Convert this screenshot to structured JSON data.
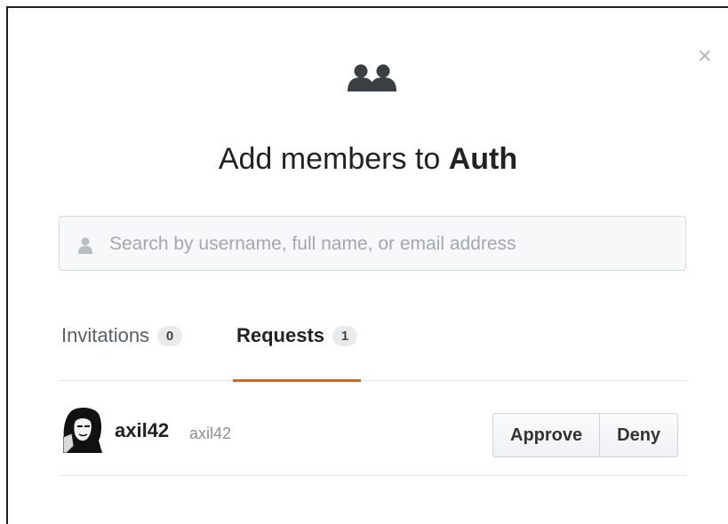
{
  "dialog": {
    "close_label": "×",
    "title_prefix": "Add members to ",
    "title_team": "Auth"
  },
  "search": {
    "placeholder": "Search by username, full name, or email address",
    "value": ""
  },
  "tabs": [
    {
      "label": "Invitations",
      "count": "0",
      "active": false
    },
    {
      "label": "Requests",
      "count": "1",
      "active": true
    }
  ],
  "requests": [
    {
      "login": "axil42",
      "name": "axil42",
      "approve_label": "Approve",
      "deny_label": "Deny"
    }
  ],
  "colors": {
    "active_tab_underline": "#e36209",
    "text": "#222222",
    "muted": "#8a9096"
  },
  "icons": {
    "team": "people-icon",
    "search": "user-icon",
    "close": "close-icon"
  }
}
